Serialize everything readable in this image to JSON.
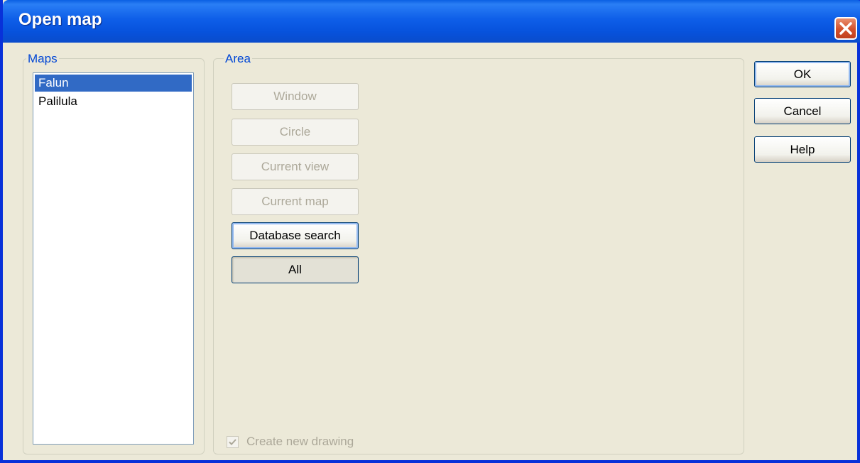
{
  "dialog": {
    "title": "Open map",
    "close_icon": "close-icon"
  },
  "maps": {
    "label": "Maps",
    "items": [
      {
        "label": "Falun",
        "selected": true
      },
      {
        "label": "Palilula",
        "selected": false
      }
    ]
  },
  "area": {
    "label": "Area",
    "buttons": {
      "window": "Window",
      "circle": "Circle",
      "current_view": "Current view",
      "current_map": "Current map",
      "database_search": "Database search",
      "all": "All"
    },
    "create_new_drawing": {
      "label": "Create new drawing",
      "checked": true,
      "enabled": false
    }
  },
  "actions": {
    "ok": "OK",
    "cancel": "Cancel",
    "help": "Help"
  },
  "colors": {
    "title_bar": "#0a5fe3",
    "face": "#ece9d8",
    "selection": "#316ac5",
    "group_label": "#0046d5",
    "close_button": "#d4502b"
  }
}
